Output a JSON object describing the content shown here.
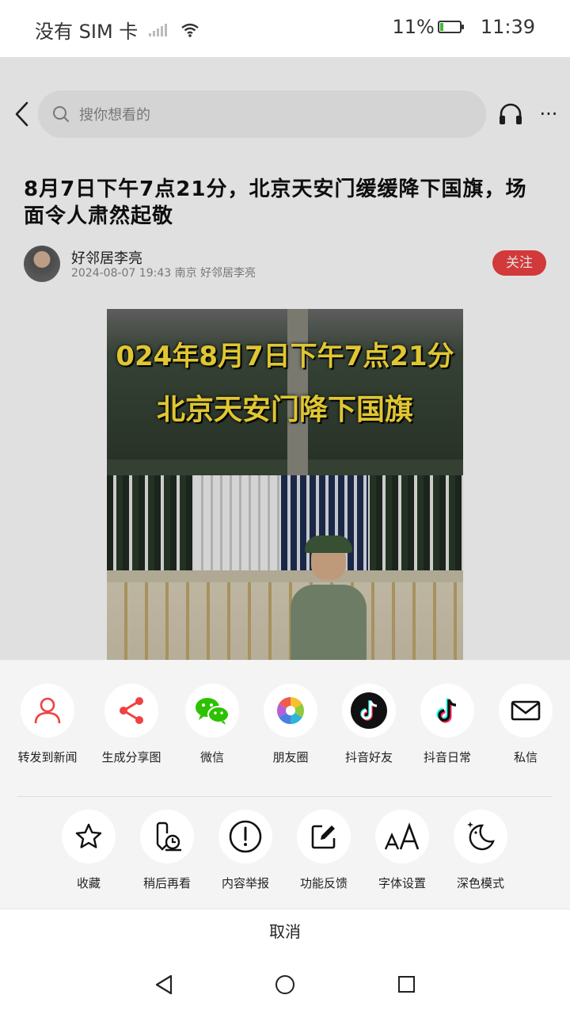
{
  "status_bar": {
    "carrier": "没有 SIM 卡",
    "battery": "11%",
    "time": "11:39"
  },
  "topbar": {
    "search_placeholder": "搜你想看的"
  },
  "article": {
    "title": "8月7日下午7点21分，北京天安门缓缓降下国旗，场面令人肃然起敬",
    "author_name": "好邻居李亮",
    "author_meta": "2024-08-07 19:43 南京 好邻居李亮",
    "follow_label": "关注",
    "image_caption_line1": "024年8月7日下午7点21分",
    "image_caption_line2": "北京天安门降下国旗"
  },
  "share_row": [
    {
      "label": "转发到新闻",
      "icon": "person-icon"
    },
    {
      "label": "生成分享图",
      "icon": "share-icon"
    },
    {
      "label": "微信",
      "icon": "wechat-icon"
    },
    {
      "label": "朋友圈",
      "icon": "moments-icon"
    },
    {
      "label": "抖音好友",
      "icon": "douyin-friends-icon"
    },
    {
      "label": "抖音日常",
      "icon": "douyin-daily-icon"
    },
    {
      "label": "私信",
      "icon": "mail-icon"
    }
  ],
  "action_row": [
    {
      "label": "收藏",
      "icon": "star-icon"
    },
    {
      "label": "稍后再看",
      "icon": "watch-later-icon"
    },
    {
      "label": "内容举报",
      "icon": "report-icon"
    },
    {
      "label": "功能反馈",
      "icon": "feedback-icon"
    },
    {
      "label": "字体设置",
      "icon": "font-size-icon"
    },
    {
      "label": "深色模式",
      "icon": "dark-mode-icon"
    }
  ],
  "cancel_label": "取消",
  "colors": {
    "accent_red": "#f04142",
    "sheet_bg": "#f4f4f4"
  }
}
